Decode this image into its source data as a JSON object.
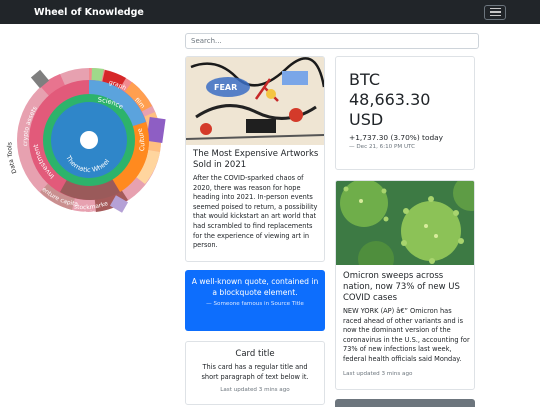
{
  "navbar": {
    "brand": "Wheel of Knowledge"
  },
  "search": {
    "placeholder": "Search..."
  },
  "sunburst": {
    "center_label": "Thematic Wheel",
    "inner_labels": {
      "science": "Science",
      "culture": "Culture",
      "investment": "Investment"
    },
    "outer_labels": {
      "graph": "graph",
      "film": "film",
      "crypto_assets": "crypto assets",
      "data_tools": "Data Tools",
      "venture": "enture capita",
      "stock": "stockmarke",
      "axis": "Axis"
    },
    "colors": {
      "core": "#2f86c9",
      "blue_ring": "#5ba3dd",
      "green_ring": "#2db36b",
      "orange": "#ff8a1f",
      "pink": "#e25a7a",
      "purple": "#8e5ec4",
      "red": "#d62728",
      "brown": "#9a5a5a"
    }
  },
  "artwork_card": {
    "title": "The Most Expensive Artworks Sold in 2021",
    "text": "After the COVID-sparked chaos of 2020, there was reason for hope heading into 2021. In-person events seemed poised to return, a possibility that would kickstart an art world that had scrambled to find replacements for the experience of viewing art in person."
  },
  "btc_card": {
    "symbol": "BTC",
    "price": "48,663.30",
    "currency": "USD",
    "change": "+1,737.30 (3.70%) today",
    "timestamp": "— Dec 21, 6:10 PM UTC"
  },
  "omicron_card": {
    "title": "Omicron sweeps across nation, now 73% of new US COVID cases",
    "text": "NEW YORK (AP) â€” Omicron has raced ahead of other variants and is now the dominant version of the coronavirus in the U.S., accounting for 73% of new infections last week, federal health officials said Monday.",
    "updated": "Last updated 3 mins ago"
  },
  "quote_card": {
    "text": "A well-known quote, contained in a blockquote element.",
    "attribution": "— Someone famous in Source Title"
  },
  "plain_card": {
    "title": "Card title",
    "text": "This card has a regular title and short paragraph of text below it.",
    "updated": "Last updated 3 mins ago"
  }
}
